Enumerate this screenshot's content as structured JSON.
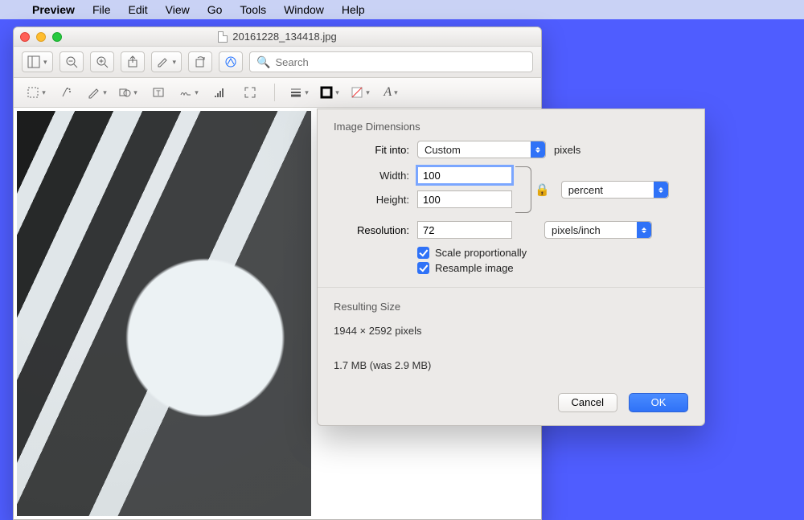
{
  "menubar": {
    "app": "Preview",
    "items": [
      "File",
      "Edit",
      "View",
      "Go",
      "Tools",
      "Window",
      "Help"
    ]
  },
  "window": {
    "title": "20161228_134418.jpg",
    "search_placeholder": "Search"
  },
  "dialog": {
    "group1_title": "Image Dimensions",
    "fit_label": "Fit into:",
    "fit_value": "Custom",
    "fit_unit": "pixels",
    "width_label": "Width:",
    "width_value": "100",
    "height_label": "Height:",
    "height_value": "100",
    "wh_unit": "percent",
    "res_label": "Resolution:",
    "res_value": "72",
    "res_unit": "pixels/inch",
    "scale_label": "Scale proportionally",
    "resample_label": "Resample image",
    "group2_title": "Resulting Size",
    "result_dims": "1944 × 2592 pixels",
    "result_bytes": "1.7 MB (was 2.9 MB)",
    "cancel": "Cancel",
    "ok": "OK"
  }
}
